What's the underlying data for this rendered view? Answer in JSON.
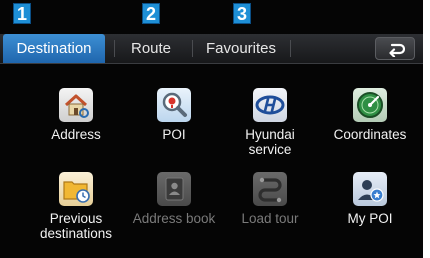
{
  "callouts": [
    "1",
    "2",
    "3"
  ],
  "tabs": [
    {
      "label": "Destination",
      "active": true
    },
    {
      "label": "Route",
      "active": false
    },
    {
      "label": "Favourites",
      "active": false
    }
  ],
  "back_icon": "back-arrow-icon",
  "menu": {
    "items": [
      {
        "label": "Address",
        "icon": "house-icon",
        "enabled": true
      },
      {
        "label": "POI",
        "icon": "poi-magnifier-icon",
        "enabled": true
      },
      {
        "label": "Hyundai\nservice",
        "icon": "hyundai-logo-icon",
        "enabled": true
      },
      {
        "label": "Coordinates",
        "icon": "compass-icon",
        "enabled": true
      },
      {
        "label": "Previous\ndestinations",
        "icon": "folder-clock-icon",
        "enabled": true
      },
      {
        "label": "Address book",
        "icon": "address-book-icon",
        "enabled": false
      },
      {
        "label": "Load tour",
        "icon": "load-tour-icon",
        "enabled": false
      },
      {
        "label": "My POI",
        "icon": "my-poi-icon",
        "enabled": true
      }
    ]
  },
  "colors": {
    "accent": "#2f7ec6",
    "background": "#050505",
    "disabled_text": "#7a7a7a"
  }
}
